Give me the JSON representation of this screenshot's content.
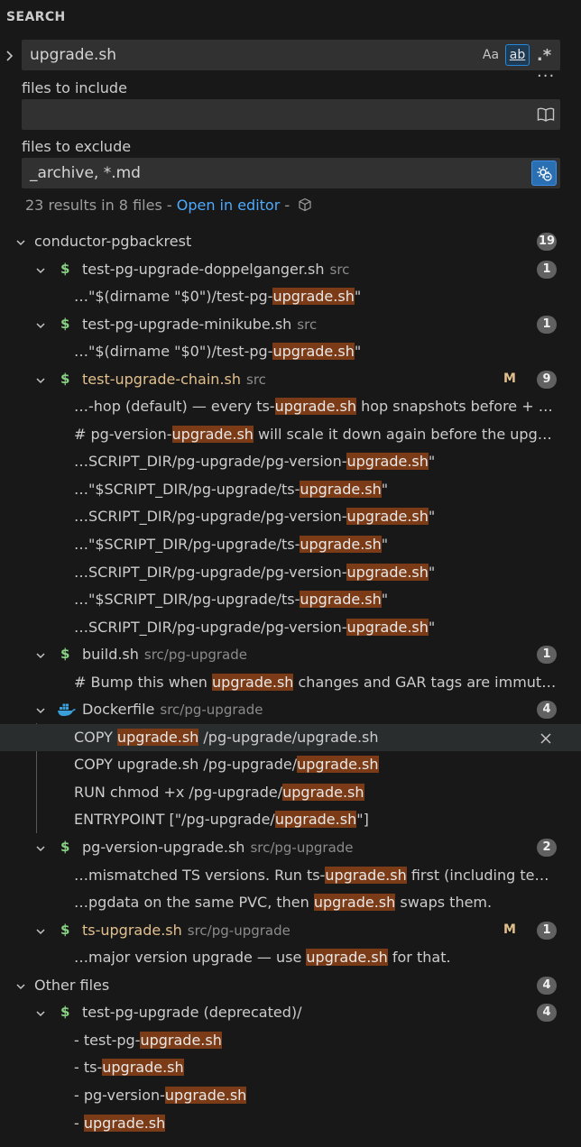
{
  "panel": {
    "title": "SEARCH"
  },
  "search": {
    "query": "upgrade.sh",
    "opt_case": "Aa",
    "opt_word": "ab",
    "opt_regex": ".*",
    "include_label": "files to include",
    "include_value": "",
    "exclude_label": "files to exclude",
    "exclude_value": "_archive, *.md"
  },
  "summary": {
    "text": "23 results in 8 files - ",
    "link": "Open in editor",
    "sep": " - "
  },
  "colors": {
    "accent": "#2488db",
    "highlight": "#7b3b16",
    "link": "#4daafc",
    "modified": "#e2c08d",
    "shell_icon": "#89d185"
  },
  "tree": [
    {
      "kind": "folder",
      "label": "conductor-pgbackrest",
      "badge": "19"
    },
    {
      "kind": "file",
      "icon": "$",
      "label": "test-pg-upgrade-doppelganger.sh",
      "path": "src",
      "badge": "1"
    },
    {
      "kind": "match",
      "parts": [
        "…\"$(dirname \"$0\")/test-pg-",
        "upgrade.sh",
        "\""
      ]
    },
    {
      "kind": "file",
      "icon": "$",
      "label": "test-pg-upgrade-minikube.sh",
      "path": "src",
      "badge": "1"
    },
    {
      "kind": "match",
      "parts": [
        "…\"$(dirname \"$0\")/test-pg-",
        "upgrade.sh",
        "\""
      ]
    },
    {
      "kind": "file",
      "icon": "$",
      "label": "test-upgrade-chain.sh",
      "path": "src",
      "badge": "9",
      "modified": "M",
      "warn": true
    },
    {
      "kind": "match",
      "parts": [
        "…-hop (default) — every ts-",
        "upgrade.sh",
        " hop snapshots before + …"
      ]
    },
    {
      "kind": "match",
      "parts": [
        "# pg-version-",
        "upgrade.sh",
        " will scale it down again before the upg…"
      ]
    },
    {
      "kind": "match",
      "parts": [
        "…SCRIPT_DIR/pg-upgrade/pg-version-",
        "upgrade.sh",
        "\""
      ]
    },
    {
      "kind": "match",
      "parts": [
        "…\"$SCRIPT_DIR/pg-upgrade/ts-",
        "upgrade.sh",
        "\""
      ]
    },
    {
      "kind": "match",
      "parts": [
        "…SCRIPT_DIR/pg-upgrade/pg-version-",
        "upgrade.sh",
        "\""
      ]
    },
    {
      "kind": "match",
      "parts": [
        "…\"$SCRIPT_DIR/pg-upgrade/ts-",
        "upgrade.sh",
        "\""
      ]
    },
    {
      "kind": "match",
      "parts": [
        "…SCRIPT_DIR/pg-upgrade/pg-version-",
        "upgrade.sh",
        "\""
      ]
    },
    {
      "kind": "match",
      "parts": [
        "…\"$SCRIPT_DIR/pg-upgrade/ts-",
        "upgrade.sh",
        "\""
      ]
    },
    {
      "kind": "match",
      "parts": [
        "…SCRIPT_DIR/pg-upgrade/pg-version-",
        "upgrade.sh",
        "\""
      ]
    },
    {
      "kind": "file",
      "icon": "$",
      "label": "build.sh",
      "path": "src/pg-upgrade",
      "badge": "1"
    },
    {
      "kind": "match",
      "parts": [
        "# Bump this when ",
        "upgrade.sh",
        " changes and GAR tags are immut…"
      ]
    },
    {
      "kind": "file",
      "icon": "docker",
      "label": "Dockerfile",
      "path": "src/pg-upgrade",
      "badge": "4"
    },
    {
      "kind": "match",
      "parts": [
        "COPY ",
        "upgrade.sh",
        " /pg-upgrade/upgrade.sh"
      ],
      "selected": true
    },
    {
      "kind": "match",
      "parts": [
        "COPY upgrade.sh /pg-upgrade/",
        "upgrade.sh",
        ""
      ]
    },
    {
      "kind": "match",
      "parts": [
        "RUN chmod +x /pg-upgrade/",
        "upgrade.sh",
        ""
      ]
    },
    {
      "kind": "match",
      "parts": [
        "ENTRYPOINT [\"/pg-upgrade/",
        "upgrade.sh",
        "\"]"
      ]
    },
    {
      "kind": "file",
      "icon": "$",
      "label": "pg-version-upgrade.sh",
      "path": "src/pg-upgrade",
      "badge": "2"
    },
    {
      "kind": "match",
      "parts": [
        "…mismatched TS versions. Run ts-",
        "upgrade.sh",
        " first (including te…"
      ]
    },
    {
      "kind": "match",
      "parts": [
        "…pgdata on the same PVC, then ",
        "upgrade.sh",
        " swaps them."
      ]
    },
    {
      "kind": "file",
      "icon": "$",
      "label": "ts-upgrade.sh",
      "path": "src/pg-upgrade",
      "badge": "1",
      "modified": "M",
      "warn": true
    },
    {
      "kind": "match",
      "parts": [
        "…major version upgrade — use ",
        "upgrade.sh",
        " for that."
      ]
    },
    {
      "kind": "folder",
      "label": "Other files",
      "badge": "4"
    },
    {
      "kind": "file",
      "icon": "$",
      "label": "test-pg-upgrade (deprecated)/",
      "path": "",
      "badge": "4"
    },
    {
      "kind": "match",
      "parts": [
        "- test-pg-",
        "upgrade.sh",
        ""
      ]
    },
    {
      "kind": "match",
      "parts": [
        "- ts-",
        "upgrade.sh",
        ""
      ]
    },
    {
      "kind": "match",
      "parts": [
        "- pg-version-",
        "upgrade.sh",
        ""
      ]
    },
    {
      "kind": "match",
      "parts": [
        "- ",
        "upgrade.sh",
        ""
      ]
    }
  ]
}
